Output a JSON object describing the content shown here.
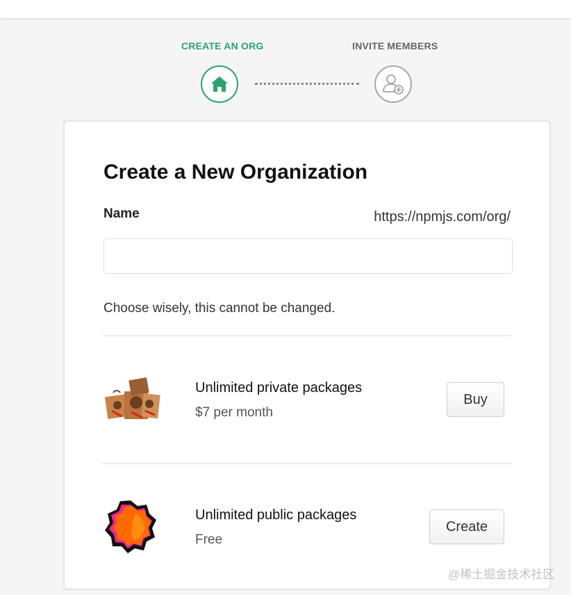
{
  "steps": [
    {
      "label": "CREATE AN ORG",
      "icon": "house-icon",
      "state": "active"
    },
    {
      "label": "INVITE MEMBERS",
      "icon": "add-user-icon",
      "state": "inactive"
    }
  ],
  "colors": {
    "accent": "#2aa270",
    "inactive": "#a8a8a8"
  },
  "form": {
    "title": "Create a New Organization",
    "name_label": "Name",
    "url_prefix": "https://npmjs.com/org/",
    "name_value": "",
    "hint": "Choose wisely, this cannot be changed."
  },
  "plans": [
    {
      "title": "Unlimited private packages",
      "price": "$7 per month",
      "button": "Buy",
      "image": "packages-boxes-illustration"
    },
    {
      "title": "Unlimited public packages",
      "price": "Free",
      "button": "Create",
      "image": "orange-badge-illustration"
    }
  ],
  "watermark": "@稀土掘金技术社区"
}
